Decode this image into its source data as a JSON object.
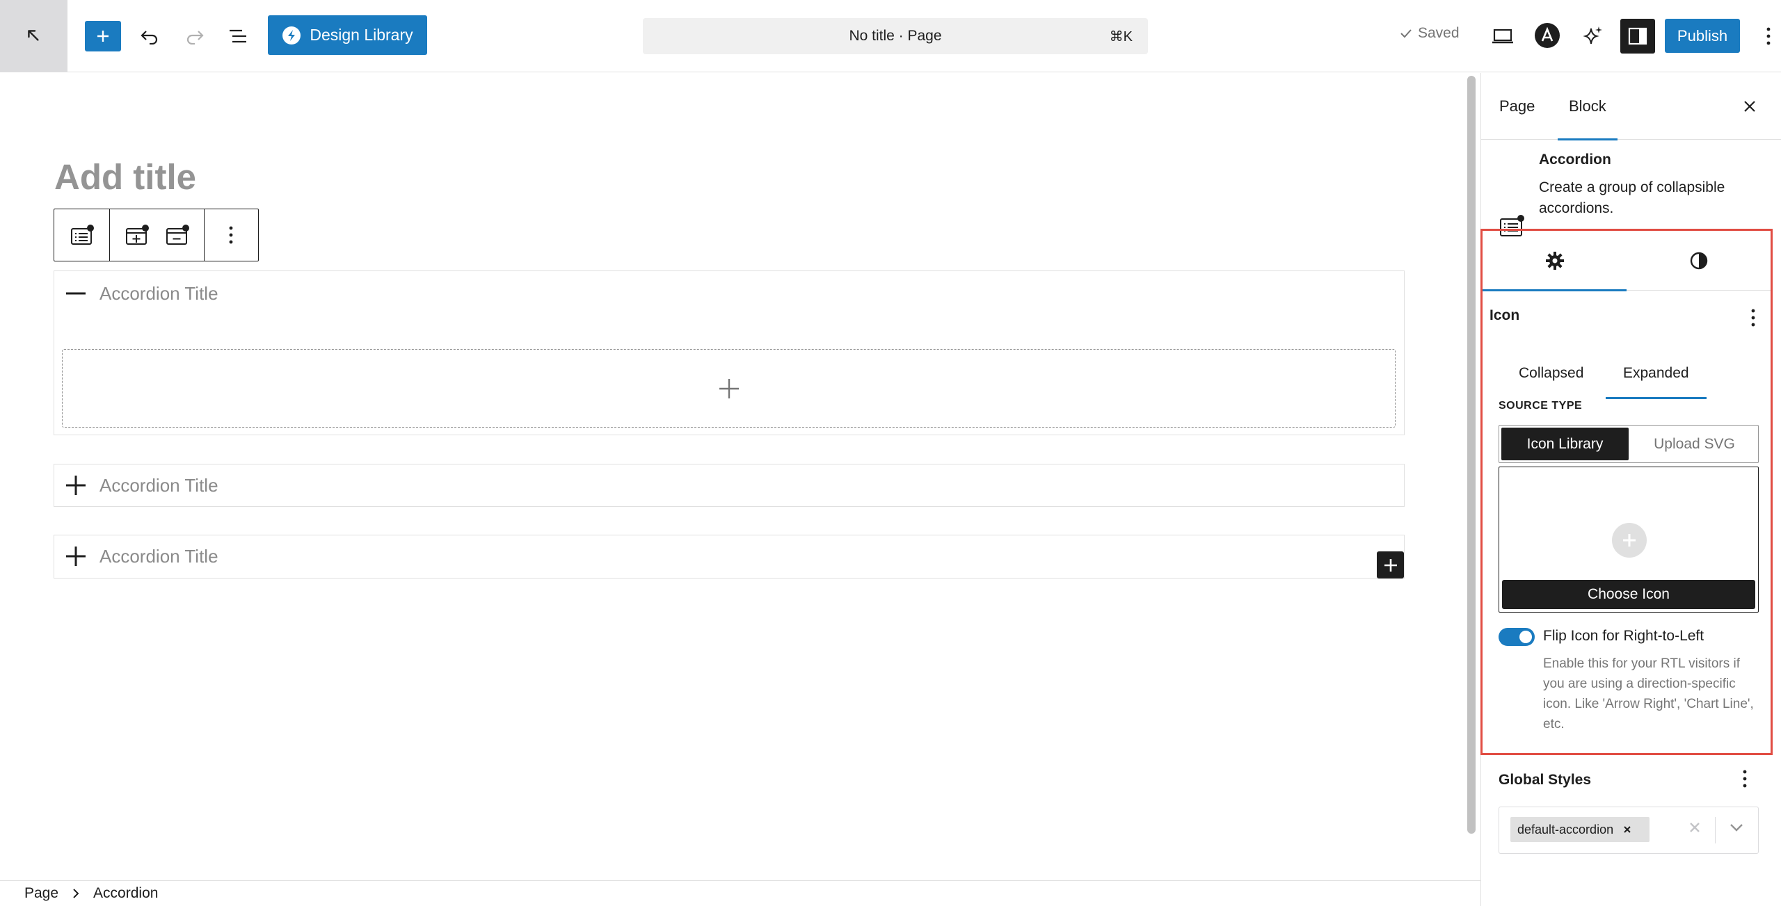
{
  "topbar": {
    "design_library_label": "Design Library",
    "document_title": "No title · Page",
    "shortcut": "⌘K",
    "saved_label": "Saved",
    "publish_label": "Publish"
  },
  "editor": {
    "title_placeholder": "Add title",
    "accordions": [
      {
        "title": "Accordion Title",
        "state": "expanded"
      },
      {
        "title": "Accordion Title",
        "state": "collapsed"
      },
      {
        "title": "Accordion Title",
        "state": "collapsed"
      }
    ]
  },
  "breadcrumb": {
    "items": [
      "Page",
      "Accordion"
    ]
  },
  "sidebar": {
    "tabs": [
      {
        "label": "Page",
        "active": false
      },
      {
        "label": "Block",
        "active": true
      }
    ],
    "block": {
      "name": "Accordion",
      "description": "Create a group of collapsible accordions."
    },
    "icon_section": {
      "title": "Icon",
      "subtabs": [
        {
          "label": "Collapsed",
          "active": false
        },
        {
          "label": "Expanded",
          "active": true
        }
      ],
      "source_type_label": "SOURCE TYPE",
      "source_options": [
        {
          "label": "Icon Library",
          "selected": true
        },
        {
          "label": "Upload SVG",
          "selected": false
        }
      ],
      "choose_icon_label": "Choose Icon",
      "flip_label": "Flip Icon for Right-to-Left",
      "flip_enabled": true,
      "flip_help": "Enable this for your RTL visitors if you are using a direction-specific icon. Like 'Arrow Right', 'Chart Line', etc."
    },
    "global_styles": {
      "title": "Global Styles",
      "selected_value": "default-accordion"
    }
  },
  "colors": {
    "accent": "#1a7bc0",
    "highlight_border": "#e14d43",
    "dark": "#1e1e1e"
  }
}
